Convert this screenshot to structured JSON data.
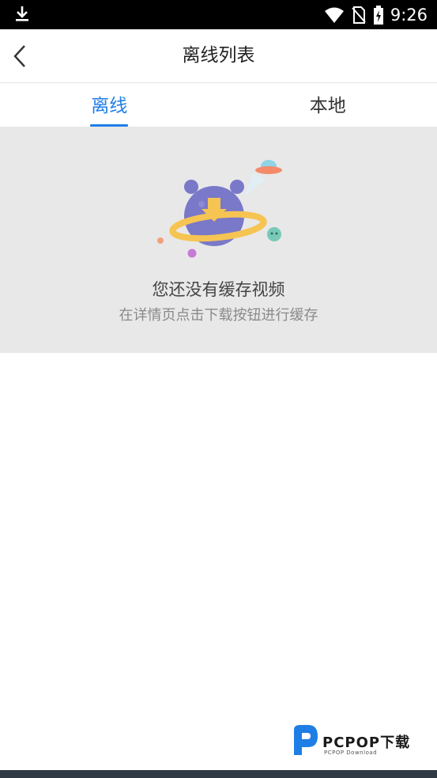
{
  "status_bar": {
    "time": "9:26",
    "icons": [
      "download-icon",
      "wifi-icon",
      "no-sim-icon",
      "battery-charging-icon"
    ]
  },
  "header": {
    "title": "离线列表",
    "back_icon": "chevron-left-icon"
  },
  "tabs": [
    {
      "label": "离线",
      "active": true
    },
    {
      "label": "本地",
      "active": false
    }
  ],
  "empty_state": {
    "title": "您还没有缓存视频",
    "subtitle": "在详情页点击下载按钮进行缓存",
    "illustration": "planet-download-illustration"
  },
  "watermark": {
    "brand": "PCPOP下载",
    "tagline": "PCPOP Download"
  },
  "colors": {
    "accent": "#1e7ee6",
    "panel_bg": "#e8e8e8",
    "status_bar_bg": "#000000"
  }
}
